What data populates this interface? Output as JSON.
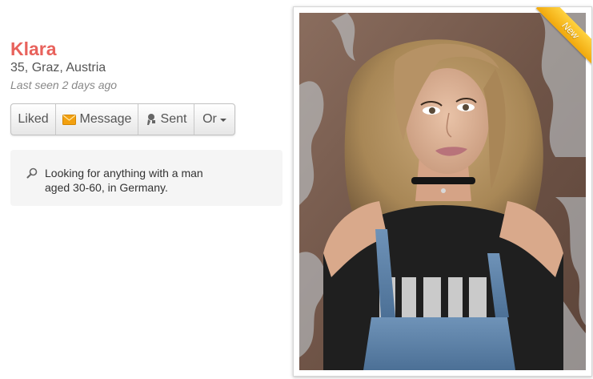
{
  "profile": {
    "name": "Klara",
    "details": "35, Graz, Austria",
    "last_seen": "Last seen 2 days ago"
  },
  "actions": {
    "liked_label": "Liked",
    "message_label": "Message",
    "message_icon": "envelope-icon",
    "sent_label": "Sent",
    "sent_icon": "gift-icon",
    "or_label": "Or"
  },
  "looking_for": {
    "icon": "search-icon",
    "text": "Looking for anything with a man aged 30-60, in Germany."
  },
  "photo": {
    "badge": "New"
  },
  "colors": {
    "name_accent": "#e8625c",
    "badge_yellow": "#f6b817",
    "envelope_orange": "#f2a00f"
  }
}
